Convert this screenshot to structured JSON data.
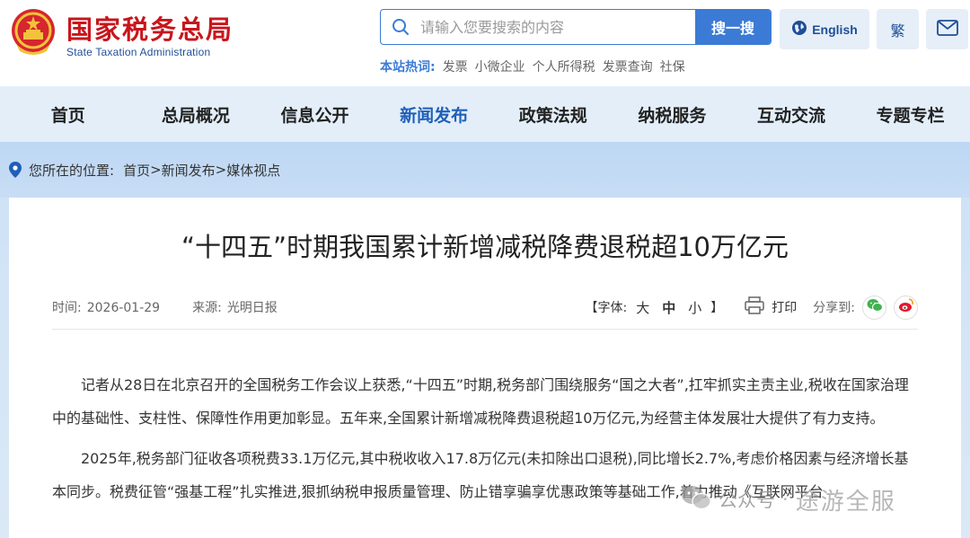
{
  "header": {
    "site_name_cn": "国家税务总局",
    "site_name_en": "State Taxation Administration",
    "search": {
      "placeholder": "请输入您要搜索的内容",
      "button_label": "搜一搜"
    },
    "hot_words": {
      "label": "本站热词:",
      "items": [
        "发票",
        "小微企业",
        "个人所得税",
        "发票查询",
        "社保"
      ]
    },
    "english_label": "English",
    "traditional_label": "繁"
  },
  "nav": {
    "items": [
      {
        "label": "首页"
      },
      {
        "label": "总局概况"
      },
      {
        "label": "信息公开"
      },
      {
        "label": "新闻发布"
      },
      {
        "label": "政策法规"
      },
      {
        "label": "纳税服务"
      },
      {
        "label": "互动交流"
      },
      {
        "label": "专题专栏"
      }
    ],
    "active_index": 3
  },
  "breadcrumb": {
    "prefix": "您所在的位置:",
    "path": [
      "首页",
      "新闻发布",
      "媒体视点"
    ],
    "separator": ">"
  },
  "article": {
    "title": "“十四五”时期我国累计新增减税降费退税超10万亿元",
    "time_label": "时间:",
    "time_value": "2026-01-29",
    "source_label": "来源:",
    "source_value": "光明日报",
    "font_label": "【字体:",
    "font_sizes": [
      "大",
      "中",
      "小"
    ],
    "font_close": "】",
    "print_label": "打印",
    "share_label": "分享到:",
    "paragraphs": [
      "记者从28日在北京召开的全国税务工作会议上获悉,“十四五”时期,税务部门围绕服务“国之大者”,扛牢抓实主责主业,税收在国家治理中的基础性、支柱性、保障性作用更加彰显。五年来,全国累计新增减税降费退税超10万亿元,为经营主体发展壮大提供了有力支持。",
      "2025年,税务部门征收各项税费33.1万亿元,其中税收收入17.8万亿元(未扣除出口退税),同比增长2.7%,考虑价格因素与经济增长基本同步。税费征管“强基工程”扎实推进,狠抓纳税申报质量管理、防止错享骗享优惠政策等基础工作,着力推动《互联网平台"
    ]
  },
  "watermark": {
    "platform": "公众号",
    "separator": "·",
    "account": "途游全服"
  },
  "colors": {
    "brand_red": "#c8161d",
    "brand_blue": "#1f4e96",
    "accent_blue": "#3b7bd6",
    "nav_bg": "#e3eef9",
    "breadcrumb_bg": "#bdd7f4"
  }
}
